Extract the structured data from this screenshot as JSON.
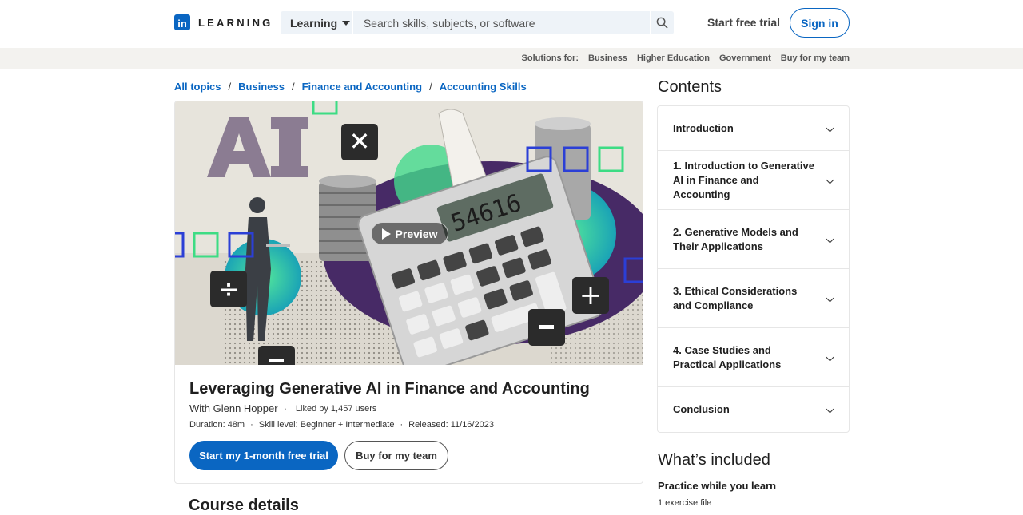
{
  "header": {
    "logo_mark": "in",
    "logo_text": "LEARNING",
    "search_category": "Learning",
    "search_placeholder": "Search skills, subjects, or software",
    "start_trial": "Start free trial",
    "sign_in": "Sign in"
  },
  "solutions": {
    "label": "Solutions for:",
    "items": [
      "Business",
      "Higher Education",
      "Government",
      "Buy for my team"
    ]
  },
  "breadcrumb": [
    "All topics",
    "Business",
    "Finance and Accounting",
    "Accounting Skills"
  ],
  "course": {
    "hero_word": "AI",
    "calculator_display": "54616",
    "preview": "Preview",
    "title": "Leveraging Generative AI in Finance and Accounting",
    "author": "With Glenn Hopper",
    "liked": "Liked by 1,457 users",
    "duration": "Duration: 48m",
    "skill": "Skill level: Beginner + Intermediate",
    "released": "Released: 11/16/2023",
    "primary_cta": "Start my 1-month free trial",
    "secondary_cta": "Buy for my team",
    "details_heading": "Course details"
  },
  "contents": {
    "title": "Contents",
    "items": [
      "Introduction",
      "1. Introduction to Generative AI in Finance and Accounting",
      "2. Generative Models and Their Applications",
      "3. Ethical Considerations and Compliance",
      "4. Case Studies and Practical Applications",
      "Conclusion"
    ]
  },
  "included": {
    "title": "What’s included",
    "practice": "Practice while you learn",
    "exercise": "1 exercise file"
  },
  "colors": {
    "brand": "#0a66c2",
    "purple": "#4a2e6e",
    "green": "#3ddc84"
  }
}
